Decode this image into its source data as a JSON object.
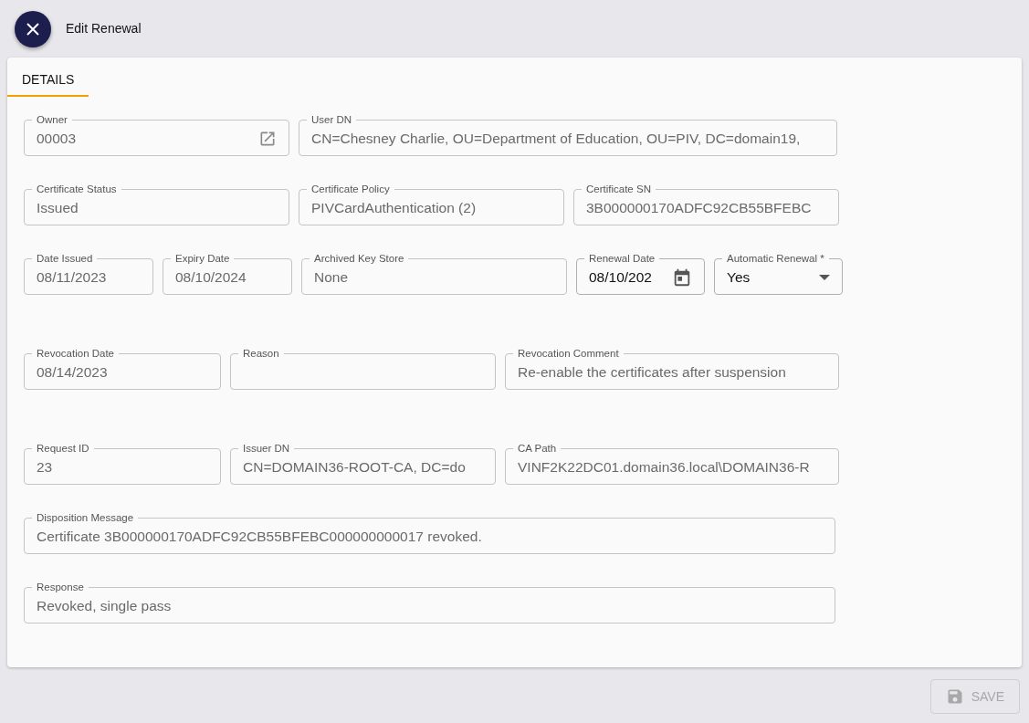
{
  "header": {
    "title": "Edit Renewal"
  },
  "tabs": [
    {
      "label": "DETAILS",
      "selected": true
    }
  ],
  "rows": [
    [
      {
        "label": "Owner",
        "value": "00003",
        "kind": "link",
        "disabled": true
      },
      {
        "label": "User DN",
        "value": "CN=Chesney Charlie, OU=Department of Education, OU=PIV, DC=domain19,",
        "kind": "text",
        "disabled": true
      }
    ],
    [
      {
        "label": "Certificate Status",
        "value": "Issued",
        "kind": "text",
        "disabled": true
      },
      {
        "label": "Certificate Policy",
        "value": "PIVCardAuthentication (2)",
        "kind": "text",
        "disabled": true
      },
      {
        "label": "Certificate SN",
        "value": "3B000000170ADFC92CB55BFEBC",
        "kind": "text",
        "disabled": true
      }
    ],
    [
      {
        "label": "Date Issued",
        "value": "08/11/2023",
        "kind": "text",
        "disabled": true
      },
      {
        "label": "Expiry Date",
        "value": "08/10/2024",
        "kind": "text",
        "disabled": true
      },
      {
        "label": "Archived Key Store",
        "value": "None",
        "kind": "text",
        "disabled": true
      },
      {
        "label": "Renewal Date",
        "value": "08/10/202",
        "kind": "date",
        "disabled": false
      },
      {
        "label": "Automatic Renewal *",
        "value": "Yes",
        "kind": "select",
        "disabled": false
      }
    ],
    [
      {
        "label": "Revocation Date",
        "value": "08/14/2023",
        "kind": "text",
        "disabled": true
      },
      {
        "label": "Reason",
        "kind": "text",
        "disabled": true
      },
      {
        "label": "Revocation Comment",
        "value": "Re-enable the certificates after suspension",
        "kind": "text",
        "disabled": true
      }
    ],
    [
      {
        "label": "Request ID",
        "value": "23",
        "kind": "text",
        "disabled": true
      },
      {
        "label": "Issuer DN",
        "value": "CN=DOMAIN36-ROOT-CA, DC=do",
        "kind": "text",
        "disabled": true
      },
      {
        "label": "CA Path",
        "value": "VINF2K22DC01.domain36.local\\DOMAIN36-R",
        "kind": "text",
        "disabled": true
      }
    ],
    [
      {
        "label": "Disposition Message",
        "value": "Certificate 3B000000170ADFC92CB55BFEBC000000000017 revoked.",
        "kind": "text",
        "disabled": true
      }
    ],
    [
      {
        "label": "Response",
        "value": "Revoked, single pass",
        "kind": "text",
        "disabled": true
      }
    ]
  ],
  "save_button": {
    "label": "SAVE",
    "disabled": true
  }
}
